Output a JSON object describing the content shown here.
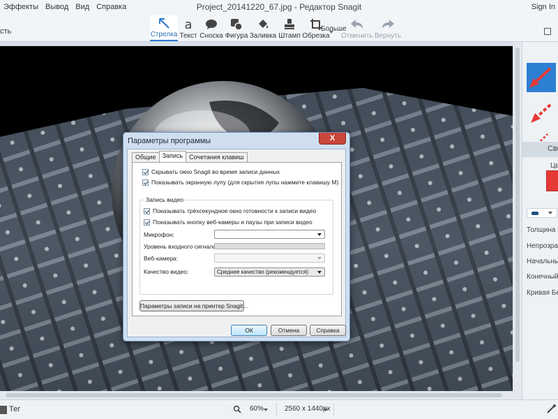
{
  "menu": [
    "Эффекты",
    "Вывод",
    "Вид",
    "Справка"
  ],
  "window_title": "Project_20141220_67.jpg - Редактор Snagit",
  "sign_in": "Sign In",
  "toolbar": {
    "left_cut_label": "сть",
    "tools": [
      {
        "label": "Стрелка",
        "icon": "arrow-cursor-icon",
        "active": true
      },
      {
        "label": "Текст",
        "icon": "text-icon",
        "active": false
      },
      {
        "label": "Сноска",
        "icon": "callout-icon",
        "active": false
      },
      {
        "label": "Фигура",
        "icon": "shape-icon",
        "active": false
      },
      {
        "label": "Заливка",
        "icon": "fill-icon",
        "active": false
      },
      {
        "label": "Штамп",
        "icon": "stamp-icon",
        "active": false
      },
      {
        "label": "Обрезка",
        "icon": "crop-icon",
        "active": false
      }
    ],
    "more_label": "Больше",
    "undo_label": "Отменить",
    "redo_label": "Вернуть"
  },
  "panel": {
    "tab_label": "Сво",
    "color_label": "Цв",
    "color_value": "#e53935",
    "props": [
      "Толщина",
      "Непрозрачн",
      "Начальный",
      "Конечный р",
      "Кривая Без"
    ]
  },
  "statusbar": {
    "tag_label": "Тег",
    "zoom": "60%",
    "image_size": "2560 x 1440px"
  },
  "dialog": {
    "title": "Параметры программы",
    "tabs": [
      {
        "label": "Общие",
        "active": false
      },
      {
        "label": "Запись",
        "active": true
      },
      {
        "label": "Сочетания клавиш",
        "active": false
      }
    ],
    "check_hide": "Скрывать окно Snagit во время записи данных",
    "check_magnifier": "Показывать экранную лупу (для скрытия лупы нажмите клавишу M)",
    "group_title": "Запись видео",
    "check_countdown": "Показывать трёхсекундное окно готовности к записи видео",
    "check_webcam": "Показывать кнопку веб-камеры и паузы при записи видео",
    "mic_label": "Микрофон:",
    "level_label": "Уровень входного сигнала:",
    "webcam_label": "Веб-камера:",
    "quality_label": "Качество видео:",
    "quality_value": "Среднее качество (рекомендуется)",
    "printer_button": "Параметры записи на принтер Snagit...",
    "ok": "ОК",
    "cancel": "Отмена",
    "help": "Справка",
    "close": "X"
  }
}
